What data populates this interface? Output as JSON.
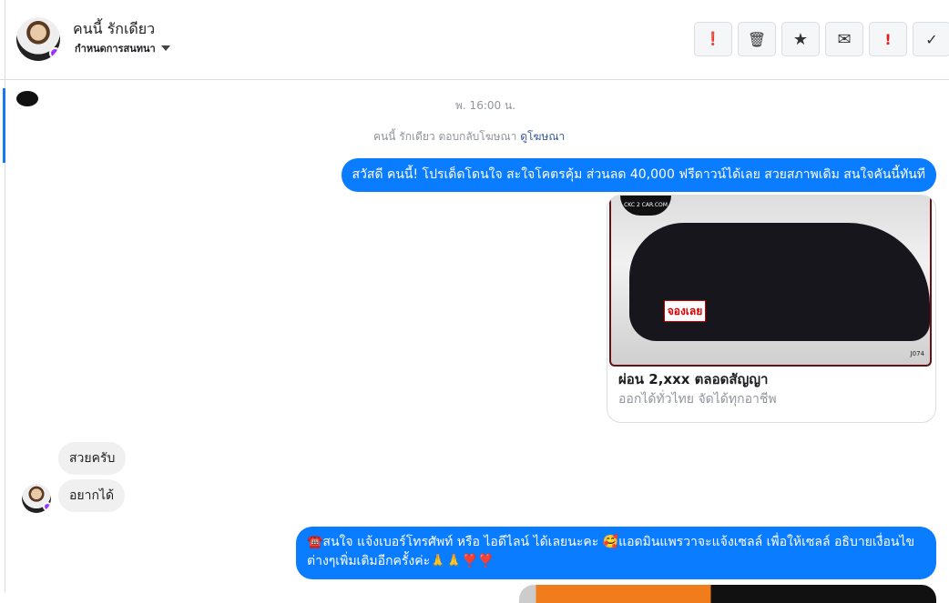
{
  "header": {
    "name": "คนนี้ รักเดียว",
    "manage_label": "กำหนดการสนทนา",
    "actions": [
      {
        "name": "alert-icon",
        "glyph": "❗"
      },
      {
        "name": "trash-icon",
        "glyph": "🗑"
      },
      {
        "name": "star-icon",
        "glyph": "★"
      },
      {
        "name": "envelope-icon",
        "glyph": "✉"
      },
      {
        "name": "spam-icon",
        "glyph": "!"
      },
      {
        "name": "check-icon",
        "glyph": "✓"
      }
    ]
  },
  "thread": {
    "timestamp": "พ. 16:00 น.",
    "ad_reply_text": "คนนี้ รักเดียว ตอบกลับโฆษณา",
    "ad_link": "ดูโฆษณา",
    "messages": [
      {
        "text": "สวัสดี คนนี้! โปรเด็ดโดนใจ สะใจโคตรคุ้ม ส่วนลด 40,000 ฟรีดาวน์ได้เลย สวยสภาพเดิม สนใจคันนี้ทันที"
      },
      {
        "text": "สวยครับ"
      },
      {
        "text": "อยากได้"
      },
      {
        "text": "☎️สนใจ แจ้งเบอร์โทรศัพท์ หรือ ไอดีไลน์  ได้เลยนะคะ 🥰แอดมินแพรวาจะแจ้งเซลล์     เพื่อให้เซลล์ อธิบายเงื่อนไขต่างๆเพิ่มเติมอีกครั้งค่ะ🙏🙏❣️❣️"
      }
    ],
    "card": {
      "title": "ผ่อน 2,xxx ตลอดสัญญา",
      "subtitle": "ออกได้ทั่วไทย จัดได้ทุกอาชีพ",
      "image_tag": "จองเลย",
      "image_logo": "CKC 2 CAR.COM",
      "image_code": "J074"
    }
  },
  "colors": {
    "accent": "#0a7cff",
    "spam": "#e41e1e"
  }
}
